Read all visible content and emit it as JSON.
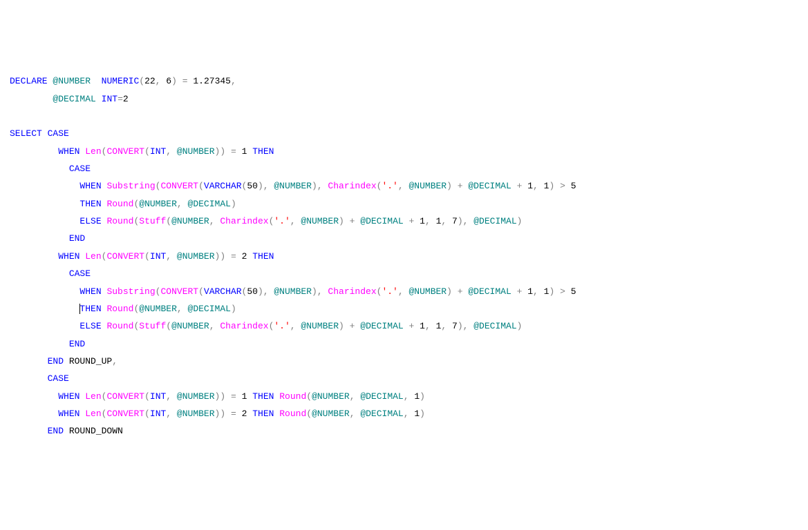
{
  "code": {
    "declare": "DECLARE",
    "atNumber": "@NUMBER",
    "numeric": "NUMERIC",
    "lparen": "(",
    "rparen": ")",
    "num22": "22",
    "comma": ",",
    "sp": " ",
    "num6": "6",
    "eq": "=",
    "val1": "1.27345",
    "atDecimal": "@DECIMAL",
    "int": "INT",
    "eq2": "=",
    "num2": "2",
    "select": "SELECT",
    "case": "CASE",
    "when": "WHEN",
    "len": "Len",
    "convert": "CONVERT",
    "num1": "1",
    "then": "THEN",
    "substring": "Substring",
    "varchar": "VARCHAR",
    "num50": "50",
    "charindex": "Charindex",
    "dotStr": "'.'",
    "plus": "+",
    "gt": ">",
    "num5": "5",
    "round": "Round",
    "else": "ELSE",
    "stuff": "Stuff",
    "num7": "7",
    "end": "END",
    "roundUp": "ROUND_UP",
    "roundDown": "ROUND_DOWN"
  }
}
